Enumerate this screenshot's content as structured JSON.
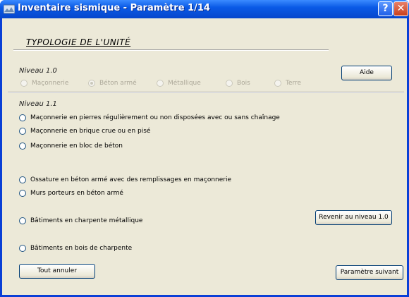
{
  "window": {
    "title": "Inventaire sismique - Paramètre 1/14",
    "help_label": "?",
    "close_label": "✕",
    "colors": {
      "titlebar": "#0a5ae6",
      "client": "#ece9d8"
    }
  },
  "section_title": "TYPOLOGIE DE L'UNITÉ",
  "level10": {
    "label": "Niveau 1.0",
    "options": [
      "Maçonnerie",
      "Béton armé",
      "Métallique",
      "Bois",
      "Terre"
    ],
    "selected": "Béton armé"
  },
  "aide_label": "Aide",
  "level11": {
    "label": "Niveau 1.1",
    "options": [
      "Maçonnerie en pierres régulièrement ou non disposées avec ou sans chaînage",
      "Maçonnerie en brique crue ou en pisé",
      "Maçonnerie en bloc de béton",
      "Ossature en béton armé avec des remplissages en maçonnerie",
      "Murs porteurs en béton armé",
      "Bâtiments en charpente métallique",
      "Bâtiments en bois de charpente"
    ]
  },
  "buttons": {
    "revenir": "Revenir au niveau 1.0",
    "tout_annuler": "Tout annuler",
    "suivant": "Paramètre suivant"
  }
}
